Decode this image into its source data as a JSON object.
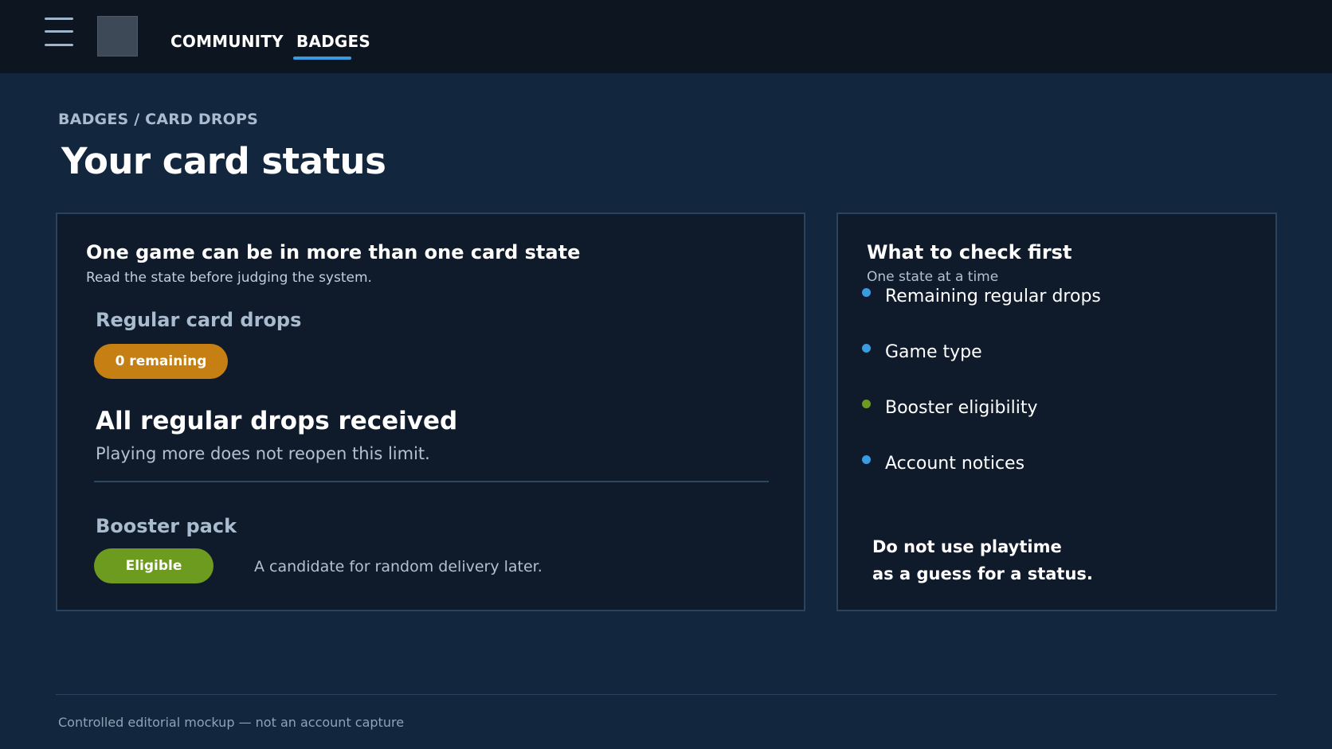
{
  "topbar": {
    "menu_icon": "hamburger-icon",
    "logo": "avatar-placeholder",
    "tabs": [
      {
        "label": "COMMUNITY",
        "active": false
      },
      {
        "label": "BADGES",
        "active": true
      }
    ],
    "accent_color": "#3b9be0"
  },
  "page": {
    "breadcrumb": "BADGES / CARD DROPS",
    "title": "Your card status"
  },
  "status_panel": {
    "title": "One game can be in more than one card state",
    "subtitle": "Read the state before judging the system.",
    "regular": {
      "label": "Regular card drops",
      "pill": "0 remaining",
      "pill_color": "#c57f12",
      "headline": "All regular drops received",
      "note": "Playing more does not reopen this limit."
    },
    "booster": {
      "label": "Booster pack",
      "pill": "Eligible",
      "pill_color": "#6c9b1f",
      "note": "A candidate for random delivery later."
    }
  },
  "check_panel": {
    "title": "What to check first",
    "subtitle": "One state at a time",
    "items": [
      {
        "label": "Remaining regular drops",
        "dot_color": "#3b9be0"
      },
      {
        "label": "Game type",
        "dot_color": "#3b9be0"
      },
      {
        "label": "Booster eligibility",
        "dot_color": "#6c9b1f"
      },
      {
        "label": "Account notices",
        "dot_color": "#3b9be0"
      }
    ],
    "warning_line1": "Do not use playtime",
    "warning_line2": "as a guess for a status."
  },
  "footer": {
    "text": "Controlled editorial mockup — not an account capture"
  }
}
